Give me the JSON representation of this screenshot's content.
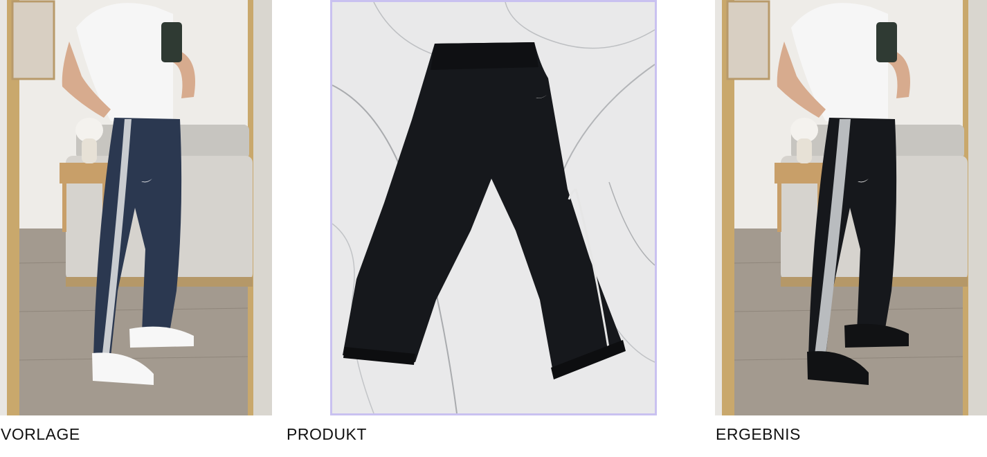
{
  "panels": [
    {
      "caption": "VORLAGE"
    },
    {
      "caption": "PRODUKT"
    },
    {
      "caption": "ERGEBNIS"
    }
  ],
  "colors": {
    "frame_accent": "#c9c1f0",
    "pants_navy": "#2b3850",
    "pants_black": "#16181c",
    "stripe_light": "#c9ccd0",
    "marble": "#e9e9ea"
  }
}
